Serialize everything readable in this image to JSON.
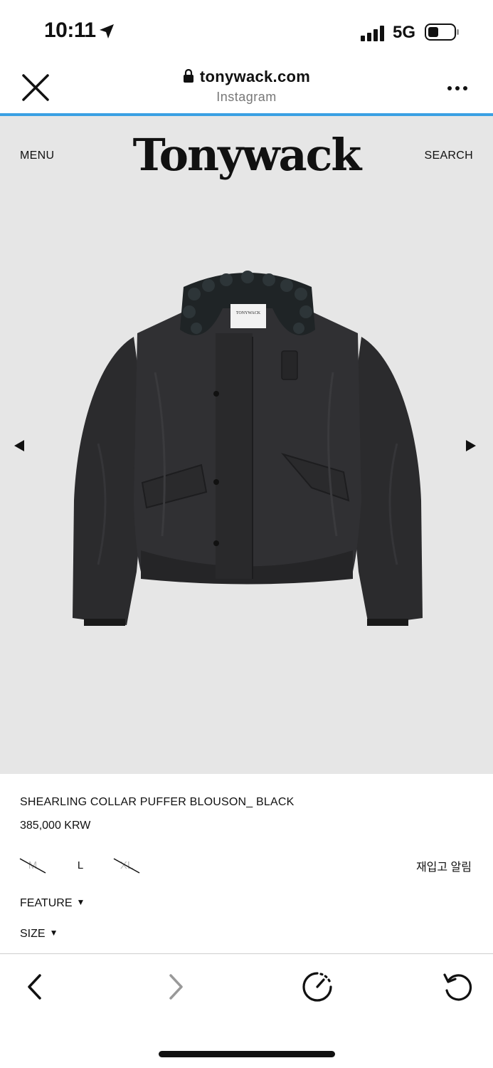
{
  "status_bar": {
    "time": "10:11",
    "network": "5G",
    "icons": [
      "location-arrow-icon",
      "signal-bars-icon",
      "battery-icon"
    ]
  },
  "browser": {
    "url": "tonywack.com",
    "source": "Instagram",
    "accent_color": "#3aa0e3"
  },
  "site": {
    "menu_label": "MENU",
    "logo": "Tonywack",
    "search_label": "SEARCH"
  },
  "product": {
    "name": "SHEARLING COLLAR PUFFER BLOUSON_ BLACK",
    "price": "385,000 KRW",
    "sizes": [
      {
        "label": "M",
        "available": false
      },
      {
        "label": "L",
        "available": true
      },
      {
        "label": "XL",
        "available": false
      }
    ],
    "restock_label": "재입고 알림",
    "feature_label": "FEATURE",
    "size_label": "SIZE",
    "image_tag": "TONYWACK"
  },
  "toolbar": {
    "icons": [
      "back-icon",
      "forward-icon",
      "speed-icon",
      "reload-icon"
    ]
  }
}
